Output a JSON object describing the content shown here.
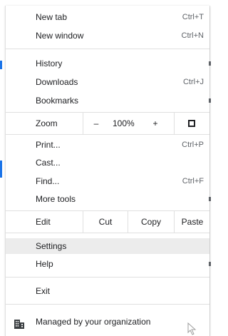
{
  "menu": {
    "items": {
      "new_tab": {
        "label": "New tab",
        "shortcut": "Ctrl+T"
      },
      "new_window": {
        "label": "New window",
        "shortcut": "Ctrl+N"
      },
      "history": {
        "label": "History"
      },
      "downloads": {
        "label": "Downloads",
        "shortcut": "Ctrl+J"
      },
      "bookmarks": {
        "label": "Bookmarks"
      },
      "print": {
        "label": "Print...",
        "shortcut": "Ctrl+P"
      },
      "cast": {
        "label": "Cast..."
      },
      "find": {
        "label": "Find...",
        "shortcut": "Ctrl+F"
      },
      "more_tools": {
        "label": "More tools"
      },
      "settings": {
        "label": "Settings"
      },
      "help": {
        "label": "Help"
      },
      "exit": {
        "label": "Exit"
      },
      "managed": {
        "label": "Managed by your organization"
      }
    },
    "zoom": {
      "label": "Zoom",
      "minus": "–",
      "value": "100%",
      "plus": "+"
    },
    "edit": {
      "label": "Edit",
      "cut": "Cut",
      "copy": "Copy",
      "paste": "Paste"
    }
  },
  "colors": {
    "highlight": "#ececec",
    "separator": "#e0e0e0"
  }
}
